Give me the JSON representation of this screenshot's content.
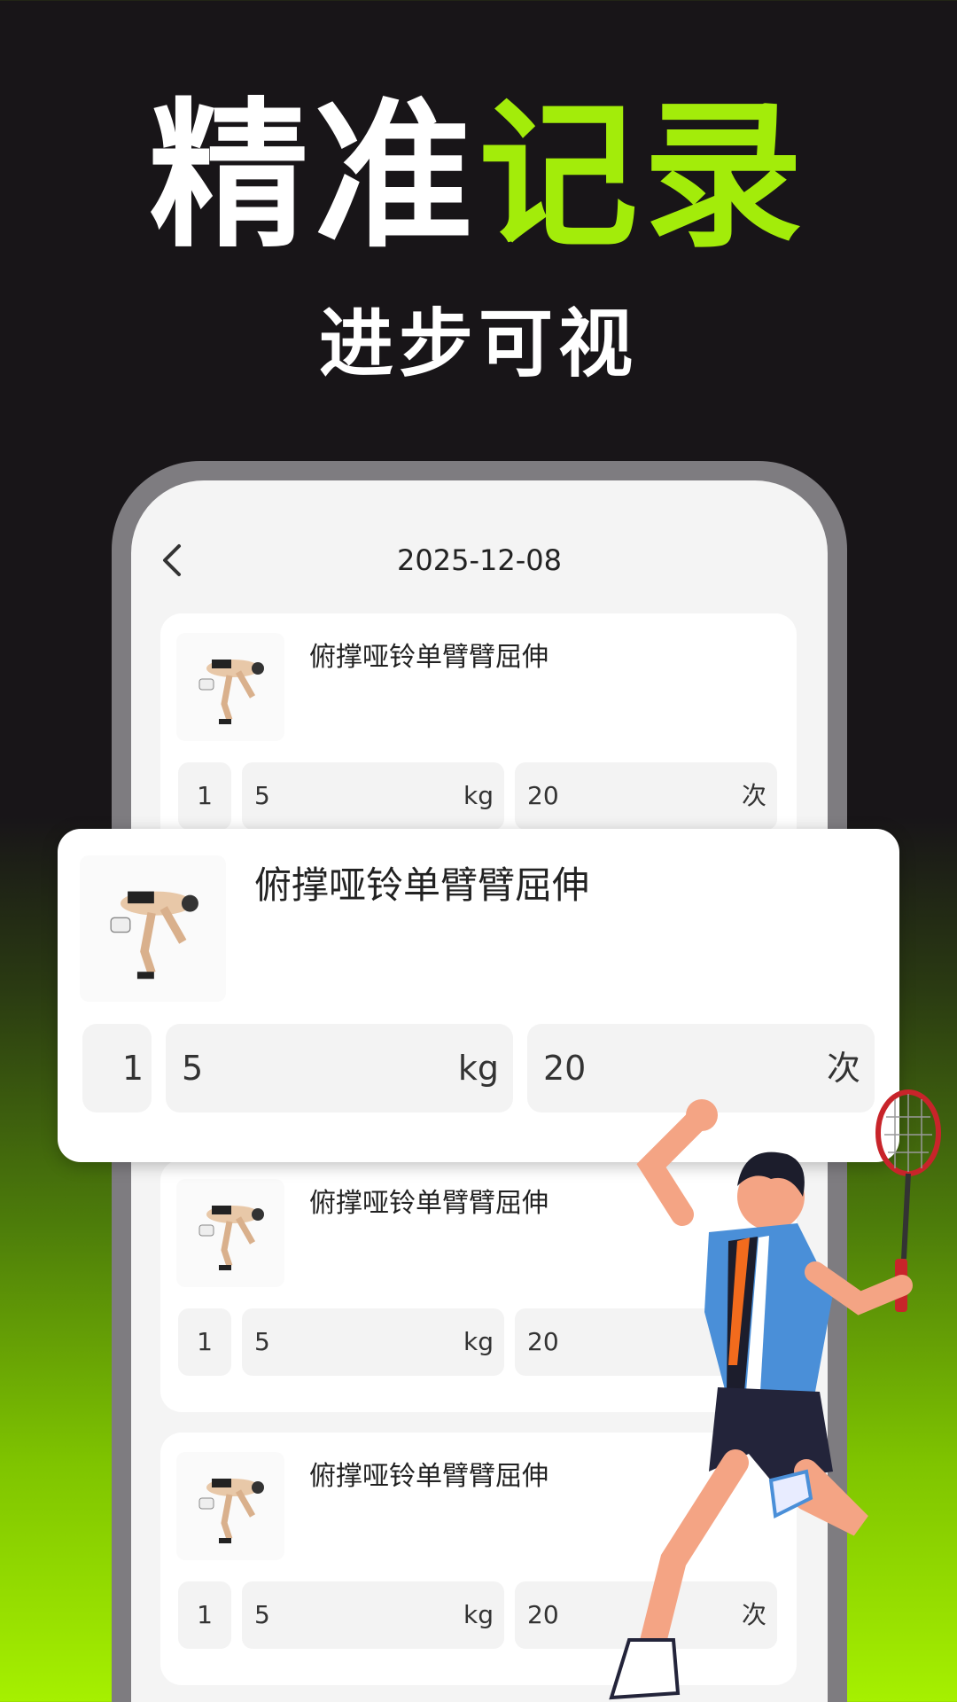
{
  "headline": {
    "part1": "精准",
    "part2": "记录"
  },
  "subline": "进步可视",
  "nav": {
    "date": "2025-12-08"
  },
  "cards": [
    {
      "title": "俯撑哑铃单臂臂屈伸",
      "set": "1",
      "weight": "5",
      "weight_unit": "kg",
      "reps": "20",
      "reps_unit": "次"
    },
    {
      "title": "俯撑哑铃单臂臂屈伸",
      "set": "1",
      "weight": "5",
      "weight_unit": "kg",
      "reps": "20",
      "reps_unit": "次"
    },
    {
      "title": "俯撑哑铃单臂臂屈伸",
      "set": "1",
      "weight": "5",
      "weight_unit": "kg",
      "reps": "20",
      "reps_unit": "次"
    }
  ],
  "highlight": {
    "title": "俯撑哑铃单臂臂屈伸",
    "set": "1",
    "weight": "5",
    "weight_unit": "kg",
    "reps": "20",
    "reps_unit": "次"
  },
  "colors": {
    "accent": "#a3ec0a",
    "background": "#181518"
  }
}
